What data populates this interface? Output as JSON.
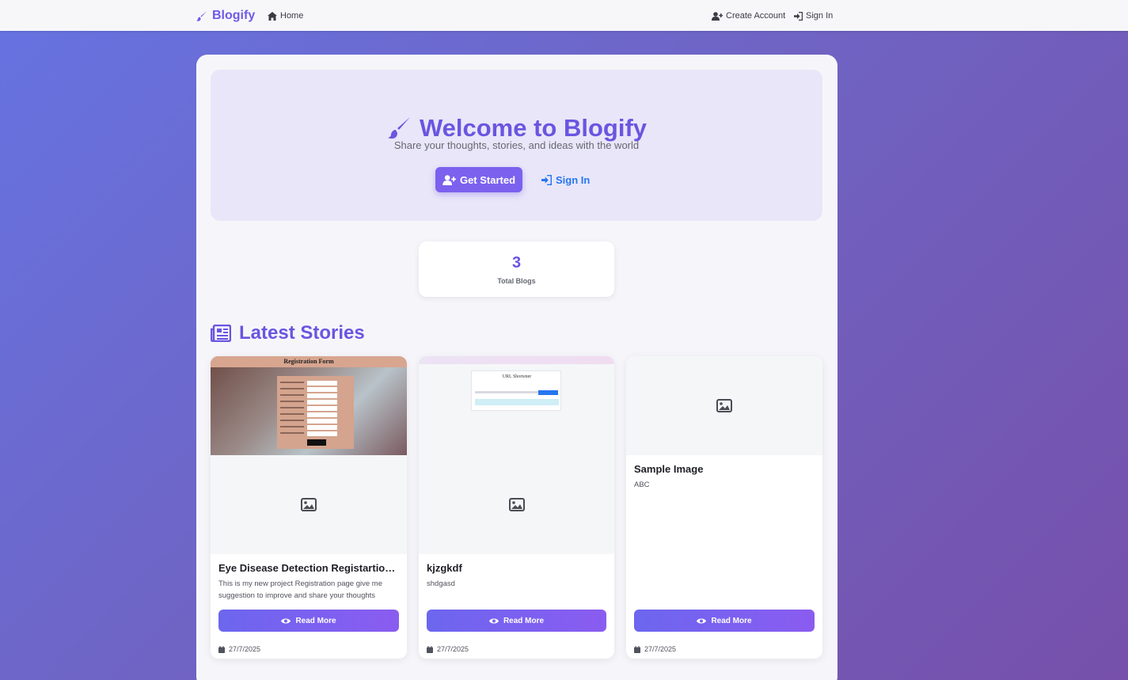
{
  "navbar": {
    "brand": "Blogify",
    "home": "Home",
    "create_account": "Create Account",
    "sign_in": "Sign In"
  },
  "hero": {
    "title": "Welcome to Blogify",
    "subtitle": "Share your thoughts, stories, and ideas with the world",
    "get_started": "Get Started",
    "sign_in": "Sign In"
  },
  "stats": {
    "total_blogs_value": "3",
    "total_blogs_label": "Total Blogs"
  },
  "section": {
    "title": "Latest Stories"
  },
  "cards": [
    {
      "title": "Eye Disease Detection Registartion f...",
      "description": "This is my new project Registration page give me suggestion to improve and share your thoughts",
      "read_more": "Read More",
      "date": "27/7/2025",
      "image_title": "Registration Form"
    },
    {
      "title": "kjzgkdf",
      "description": "shdgasd",
      "read_more": "Read More",
      "date": "27/7/2025",
      "image_title": "URL Shortener"
    },
    {
      "title": "Sample Image",
      "description": "ABC",
      "read_more": "Read More",
      "date": "27/7/2025"
    }
  ],
  "colors": {
    "accent": "#6a55e1",
    "link_blue": "#2576f0",
    "button_gradient_start": "#6c66ef",
    "button_gradient_end": "#8a5cf0"
  }
}
